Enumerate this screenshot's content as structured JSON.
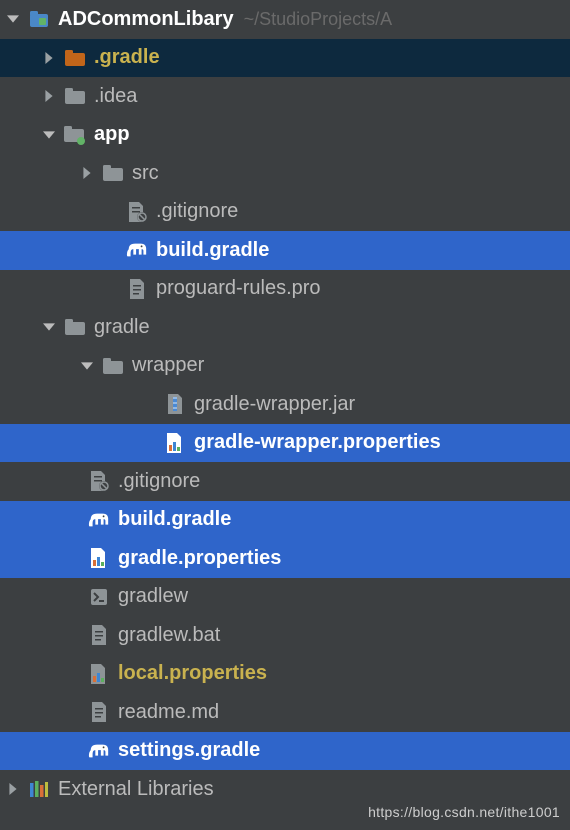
{
  "colors": {
    "selected": "#2f65ca",
    "hover": "#0d293e",
    "textNormal": "#bbbbbb",
    "textYellow": "#c9b24f",
    "textWhite": "#ffffff",
    "folderGray": "#8e9497",
    "folderOrange": "#c1651a",
    "elephant": "#9aa7b0",
    "project": "#4a88c7"
  },
  "watermark": "https://blog.csdn.net/ithe1001",
  "rows": [
    {
      "indent": 4,
      "arrow": "down",
      "icon": "project",
      "label": "ADCommonLibary",
      "bold": true,
      "hint": "~/StudioProjects/A",
      "color": "textWhite"
    },
    {
      "indent": 40,
      "arrow": "right",
      "icon": "folder-orange",
      "label": ".gradle",
      "bold": true,
      "color": "textYellow",
      "state": "hover"
    },
    {
      "indent": 40,
      "arrow": "right",
      "icon": "folder-gray",
      "label": ".idea",
      "bold": false
    },
    {
      "indent": 40,
      "arrow": "down",
      "icon": "folder-dot",
      "label": "app",
      "bold": true,
      "color": "textWhite"
    },
    {
      "indent": 78,
      "arrow": "right",
      "icon": "folder-gray",
      "label": "src",
      "bold": false
    },
    {
      "indent": 102,
      "arrow": "none",
      "icon": "file-ignore",
      "label": ".gitignore",
      "bold": false
    },
    {
      "indent": 102,
      "arrow": "none",
      "icon": "elephant",
      "label": "build.gradle",
      "bold": true,
      "state": "selected"
    },
    {
      "indent": 102,
      "arrow": "none",
      "icon": "file",
      "label": "proguard-rules.pro",
      "bold": false
    },
    {
      "indent": 40,
      "arrow": "down",
      "icon": "folder-gray",
      "label": "gradle",
      "bold": false
    },
    {
      "indent": 78,
      "arrow": "down",
      "icon": "folder-gray",
      "label": "wrapper",
      "bold": false
    },
    {
      "indent": 140,
      "arrow": "none",
      "icon": "jar",
      "label": "gradle-wrapper.jar",
      "bold": false
    },
    {
      "indent": 140,
      "arrow": "none",
      "icon": "props",
      "label": "gradle-wrapper.properties",
      "bold": true,
      "state": "selected"
    },
    {
      "indent": 64,
      "arrow": "none",
      "icon": "file-ignore",
      "label": ".gitignore",
      "bold": false
    },
    {
      "indent": 64,
      "arrow": "none",
      "icon": "elephant",
      "label": "build.gradle",
      "bold": true,
      "state": "selected"
    },
    {
      "indent": 64,
      "arrow": "none",
      "icon": "props",
      "label": "gradle.properties",
      "bold": true,
      "state": "selected"
    },
    {
      "indent": 64,
      "arrow": "none",
      "icon": "shell",
      "label": "gradlew",
      "bold": false
    },
    {
      "indent": 64,
      "arrow": "none",
      "icon": "file",
      "label": "gradlew.bat",
      "bold": false
    },
    {
      "indent": 64,
      "arrow": "none",
      "icon": "props",
      "label": "local.properties",
      "bold": true,
      "color": "textYellow"
    },
    {
      "indent": 64,
      "arrow": "none",
      "icon": "file",
      "label": "readme.md",
      "bold": false
    },
    {
      "indent": 64,
      "arrow": "none",
      "icon": "elephant",
      "label": "settings.gradle",
      "bold": true,
      "state": "selected"
    },
    {
      "indent": 4,
      "arrow": "right",
      "icon": "libs",
      "label": "External Libraries",
      "bold": false
    }
  ]
}
